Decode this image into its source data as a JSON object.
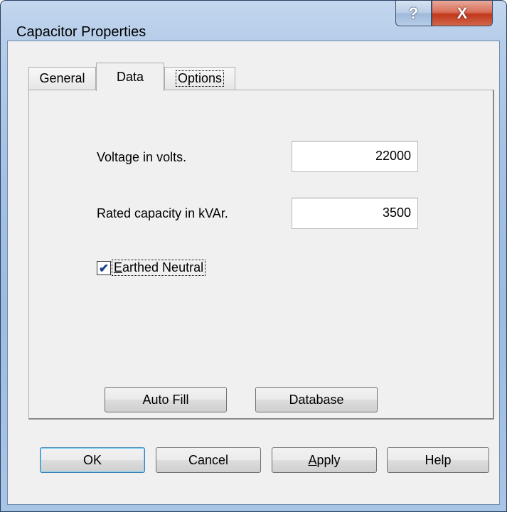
{
  "window": {
    "title": "Capacitor Properties",
    "help_glyph": "?",
    "close_glyph": "X"
  },
  "tabs": [
    {
      "label": "General",
      "selected": false
    },
    {
      "label": "Data",
      "selected": true
    },
    {
      "label": "Options",
      "selected": false
    }
  ],
  "data_tab": {
    "voltage_label": "Voltage in volts.",
    "voltage_value": "22000",
    "capacity_label": "Rated capacity in kVAr.",
    "capacity_value": "3500",
    "earthed_neutral_label": "Earthed Neutral",
    "earthed_neutral_checked": true,
    "check_glyph": "✔",
    "auto_fill_label": "Auto Fill",
    "database_label": "Database"
  },
  "footer": {
    "ok_label": "OK",
    "cancel_label": "Cancel",
    "apply_label": "Apply",
    "help_label": "Help"
  }
}
